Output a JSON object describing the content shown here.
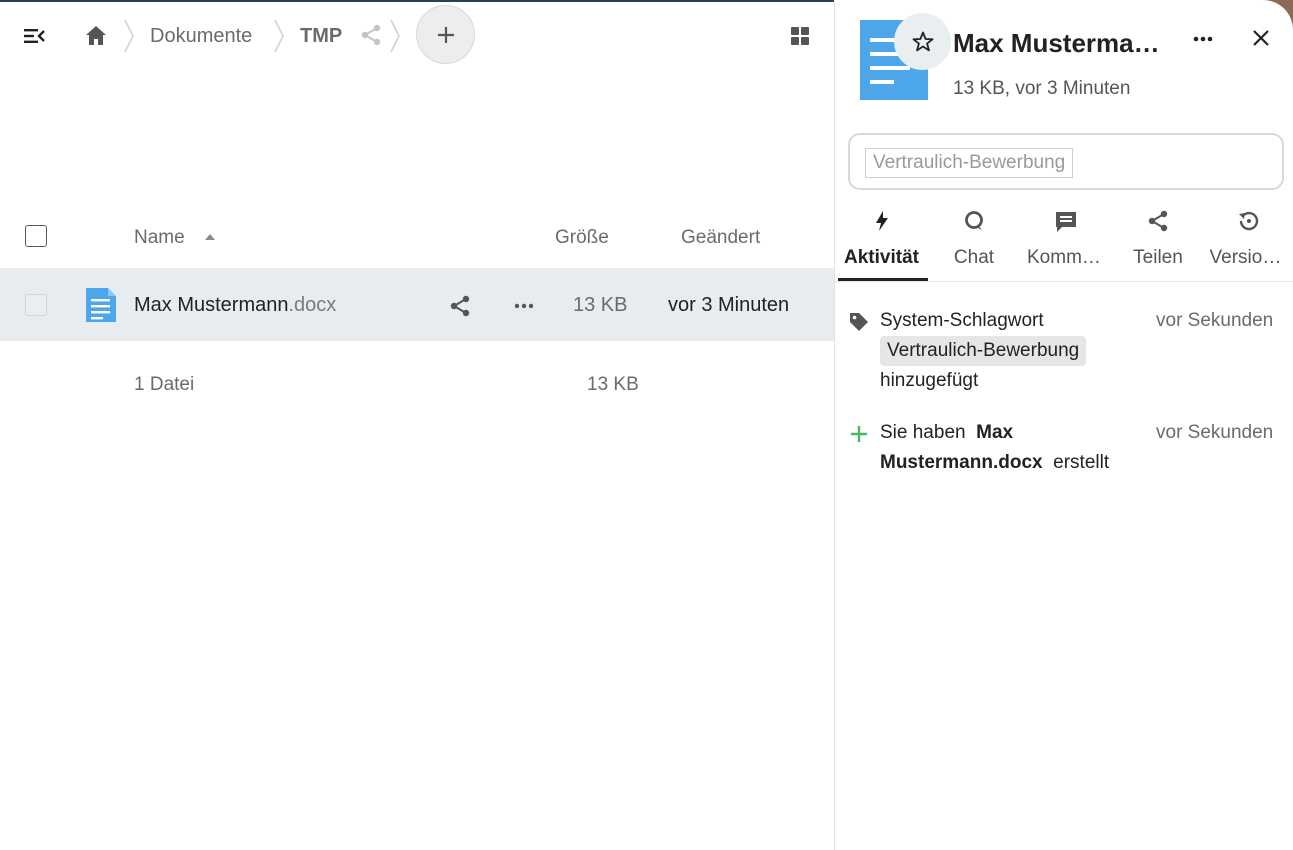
{
  "breadcrumb": {
    "items": [
      {
        "label": "Dokumente"
      },
      {
        "label": "TMP"
      }
    ]
  },
  "add_button_label": "+",
  "file_table": {
    "columns": {
      "name": "Name",
      "size": "Größe",
      "modified": "Geändert"
    },
    "rows": [
      {
        "name": "Max Mustermann",
        "extension": ".docx",
        "size": "13 KB",
        "modified": "vor 3 Minuten"
      }
    ],
    "summary": {
      "count": "1 Datei",
      "total_size": "13 KB"
    }
  },
  "sidebar": {
    "title": "Max Mustermann.docx",
    "subtitle": "13 KB, vor 3 Minuten",
    "tag_input_chip": "Vertraulich-Bewerbung",
    "tabs": [
      {
        "label": "Aktivität",
        "icon": "lightning-icon",
        "active": true
      },
      {
        "label": "Chat",
        "icon": "chat-bubble-icon",
        "active": false
      },
      {
        "label": "Kommentare",
        "icon": "comment-icon",
        "active": false
      },
      {
        "label": "Teilen",
        "icon": "share-icon",
        "active": false
      },
      {
        "label": "Versionen",
        "icon": "history-icon",
        "active": false
      }
    ],
    "activities": [
      {
        "icon": "tag-icon",
        "line1": "System-Schlagwort",
        "tag": "Vertraulich-Bewerbung",
        "line3": "hinzugefügt",
        "time": "vor Sekunden"
      },
      {
        "icon": "plus-icon",
        "prefix": "Sie haben",
        "file": "Max Mustermann.docx",
        "suffix": "erstellt",
        "time": "vor Sekunden"
      }
    ]
  },
  "colors": {
    "accent": "#4da6ea",
    "selected_row": "#e6ecf0",
    "success_green": "#46ba61"
  }
}
